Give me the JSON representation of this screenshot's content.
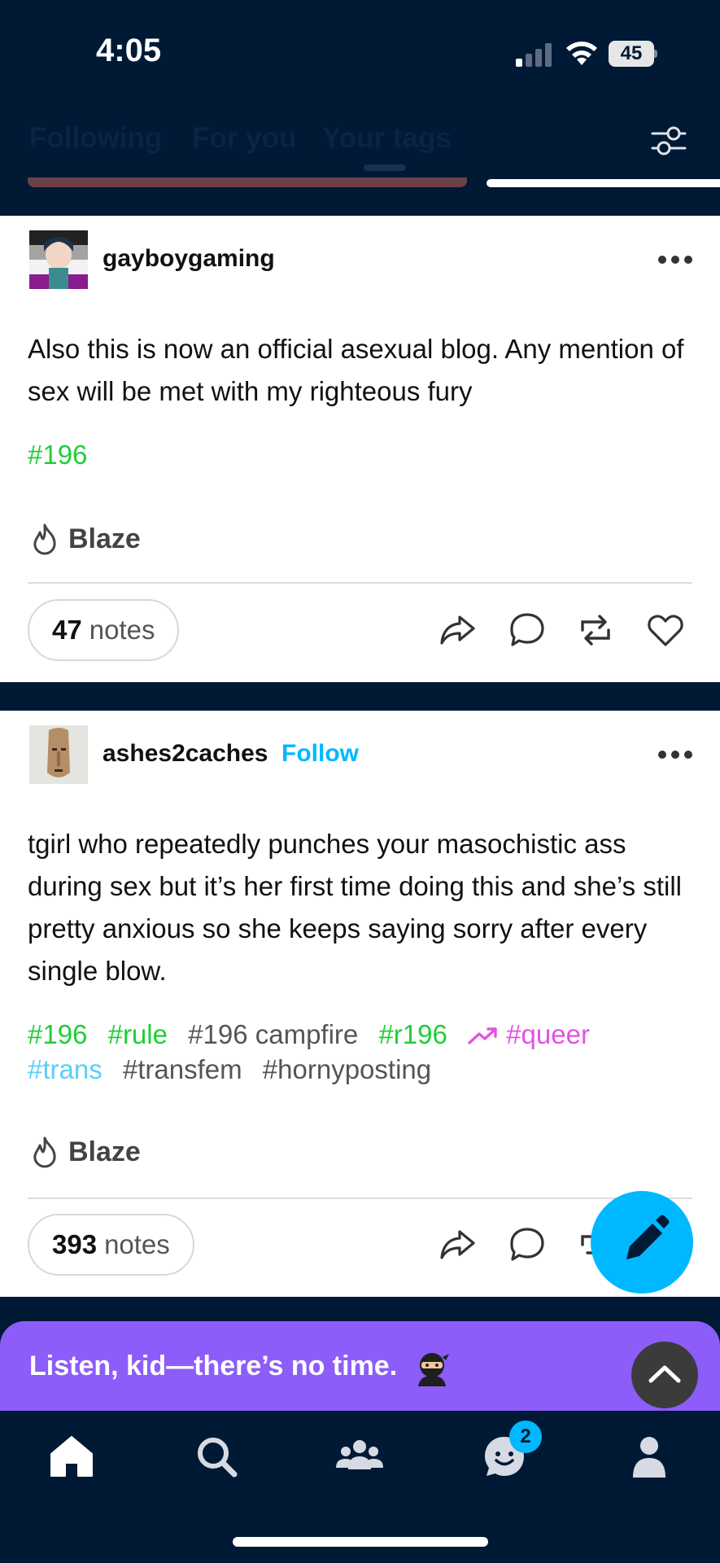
{
  "status_bar": {
    "time": "4:05",
    "battery": "45"
  },
  "tabs": [
    {
      "label": "Following"
    },
    {
      "label": "For you"
    },
    {
      "label": "Your tags"
    }
  ],
  "posts": [
    {
      "username": "gayboygaming",
      "body": "Also this is now an official asexual blog. Any mention of sex will be met with my righteous fury",
      "tags": [
        "#196"
      ],
      "blaze_label": "Blaze",
      "notes_count": "47",
      "notes_label": "notes"
    },
    {
      "username": "ashes2caches",
      "follow_label": "Follow",
      "body": "tgirl who repeatedly punches your masochistic ass during sex but it’s her first time doing this and she’s still pretty anxious so she keeps saying sorry after every single blow.",
      "tags": [
        "#196",
        "#rule",
        "#196 campfire",
        "#r196",
        "#queer",
        "#trans",
        "#transfem",
        "#hornyposting"
      ],
      "blaze_label": "Blaze",
      "notes_count": "393",
      "notes_label": "notes"
    }
  ],
  "promo": {
    "text": "Listen, kid—there’s no time."
  },
  "bottom_nav": {
    "items": [
      "home-icon",
      "search-icon",
      "communities-icon",
      "activity-icon",
      "account-icon"
    ],
    "activity_badge": "2"
  },
  "colors": {
    "background": "#001935",
    "accent_blue": "#00b8ff",
    "tag_green": "#1fce37",
    "promo_purple": "#8c5df9"
  }
}
